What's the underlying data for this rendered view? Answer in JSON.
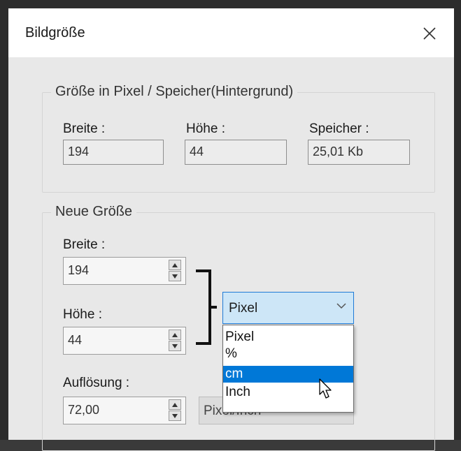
{
  "window": {
    "title": "Bildgröße"
  },
  "current_size": {
    "group_title": "Größe in Pixel / Speicher(Hintergrund)",
    "width_label": "Breite :",
    "width_value": "194",
    "height_label": "Höhe :",
    "height_value": "44",
    "memory_label": "Speicher :",
    "memory_value": "25,01 Kb"
  },
  "new_size": {
    "group_title": "Neue Größe",
    "width_label": "Breite :",
    "width_value": "194",
    "height_label": "Höhe :",
    "height_value": "44",
    "unit_selected": "Pixel",
    "unit_options": [
      "Pixel",
      "%",
      "cm",
      "Inch"
    ],
    "highlighted_option": "cm",
    "resolution_label": "Auflösung :",
    "resolution_value": "72,00",
    "resolution_unit": "Pixel/Inch"
  },
  "icons": [
    "close-icon",
    "spin-up-icon",
    "spin-down-icon",
    "chevron-down-icon",
    "mouse-cursor-icon",
    "link-bracket-icon"
  ],
  "colors": {
    "accent": "#0078d7",
    "combo_focus_bg": "#cde6f7",
    "dialog_bg": "#e8e8e8"
  }
}
